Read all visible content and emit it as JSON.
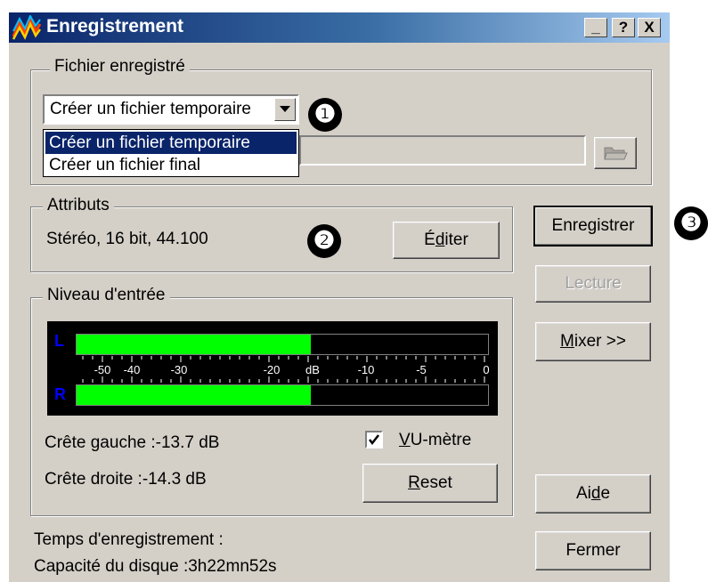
{
  "window": {
    "title": "Enregistrement",
    "controls": {
      "minimize": "_",
      "help": "?",
      "close": "X"
    }
  },
  "file_group": {
    "label": "Fichier enregistré",
    "combo_value": "Créer un fichier temporaire",
    "options": [
      "Créer un fichier temporaire",
      "Créer un fichier final"
    ],
    "selected_index": 0,
    "browse_icon": "folder-icon"
  },
  "attributes_group": {
    "label": "Attributs",
    "value": "Stéréo, 16 bit, 44.100",
    "edit_pre": "É",
    "edit_u": "d",
    "edit_post": "iter"
  },
  "level_group": {
    "label": "Niveau d'entrée",
    "left_channel": "L",
    "right_channel": "R",
    "left_level_fraction": 0.57,
    "right_level_fraction": 0.57,
    "scale_labels": [
      "-50",
      "-40",
      "-30",
      "-20",
      "dB",
      "-10",
      "-5",
      "0"
    ],
    "peak_left": "Crête gauche :-13.7 dB",
    "peak_right": "Crête droite :-14.3 dB",
    "vu_checked": true,
    "vu_u": "V",
    "vu_post": "U-mètre",
    "reset_u": "R",
    "reset_post": "eset"
  },
  "status": {
    "record_time": "Temps d'enregistrement :",
    "disk_capacity": "Capacité du disque :3h22mn52s"
  },
  "buttons": {
    "record": "Enregistrer",
    "play": "Lecture",
    "mixer_u": "M",
    "mixer_post": "ixer >>",
    "help_pre": "Ai",
    "help_u": "d",
    "help_post": "e",
    "close": "Fermer"
  },
  "markers": [
    "❶",
    "❷",
    "❸"
  ],
  "colors": {
    "title_gradient_start": "#0a246a",
    "title_gradient_end": "#a6caf0",
    "dialog_face": "#d4d0c8",
    "meter_fill": "#00ff00",
    "channel_label": "#0000ff",
    "selection": "#0a246a"
  }
}
